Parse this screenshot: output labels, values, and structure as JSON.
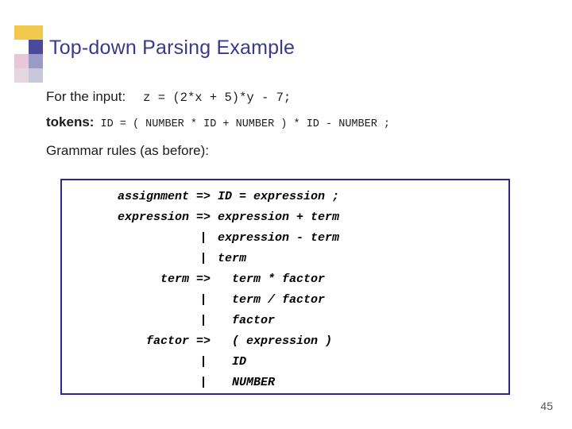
{
  "slide": {
    "title": "Top-down Parsing Example",
    "input_label": "For the input:",
    "input_code": "z = (2*x + 5)*y - 7;",
    "tokens_label": "tokens:",
    "tokens_code": "ID = ( NUMBER * ID + NUMBER ) * ID - NUMBER ;",
    "grammar_label": "Grammar rules (as before):",
    "page_number": "45"
  },
  "rules": [
    {
      "lhs": "assignment",
      "arrow": "=>",
      "rhs": "ID = expression ;"
    },
    {
      "lhs": "expression",
      "arrow": "=>",
      "rhs": "expression + term"
    },
    {
      "lhs": "",
      "arrow": "|",
      "rhs": "expression - term"
    },
    {
      "lhs": "",
      "arrow": "|",
      "rhs": "term"
    },
    {
      "lhs": "term",
      "arrow": "=>",
      "rhs": "  term * factor"
    },
    {
      "lhs": "",
      "arrow": "|",
      "rhs": "  term / factor"
    },
    {
      "lhs": "",
      "arrow": "|",
      "rhs": "  factor"
    },
    {
      "lhs": "factor",
      "arrow": "=>",
      "rhs": "  ( expression )"
    },
    {
      "lhs": "",
      "arrow": "|",
      "rhs": "  ID"
    },
    {
      "lhs": "",
      "arrow": "|",
      "rhs": "  NUMBER"
    }
  ],
  "colors": {
    "title": "#3a3a8c",
    "box_border": "#2a2a8c",
    "deco_yellow": "#f2c94c",
    "deco_blue": "#4a4a9c"
  }
}
